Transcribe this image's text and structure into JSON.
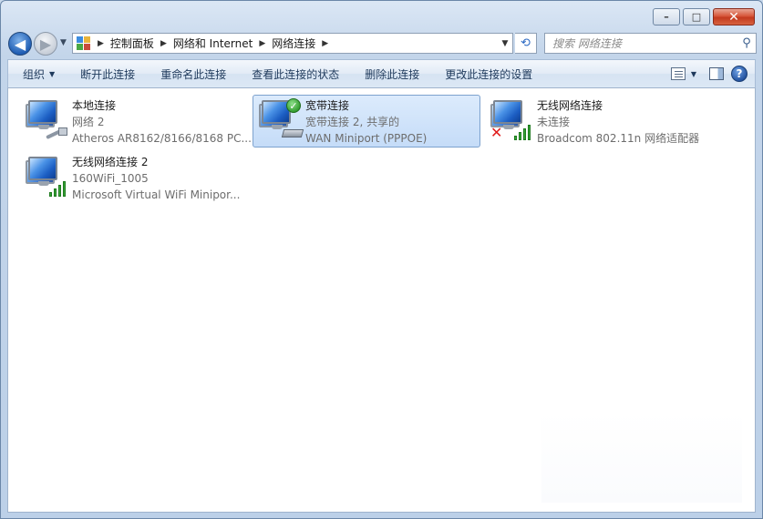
{
  "window": {
    "controls": {
      "minimize": "–",
      "maximize": "□",
      "close": "✕"
    }
  },
  "nav": {
    "back_icon": "back-arrow-icon",
    "forward_icon": "forward-arrow-icon",
    "breadcrumbs": [
      "控制面板",
      "网络和 Internet",
      "网络连接"
    ],
    "search_placeholder": "搜索 网络连接"
  },
  "toolbar": {
    "organize": "组织",
    "commands": [
      "断开此连接",
      "重命名此连接",
      "查看此连接的状态",
      "删除此连接",
      "更改此连接的设置"
    ]
  },
  "connections": [
    {
      "name": "本地连接",
      "status": "网络  2",
      "device": "Atheros AR8162/8166/8168 PC...",
      "type": "ethernet",
      "selected": false
    },
    {
      "name": "宽带连接",
      "status": "宽带连接  2, 共享的",
      "device": "WAN Miniport (PPPOE)",
      "type": "broadband-connected",
      "selected": true
    },
    {
      "name": "无线网络连接",
      "status": "未连接",
      "device": "Broadcom 802.11n 网络适配器",
      "type": "wireless-disconnected",
      "selected": false
    },
    {
      "name": "无线网络连接 2",
      "status": "160WiFi_1005",
      "device": "Microsoft Virtual WiFi Minipor...",
      "type": "wireless",
      "selected": false
    }
  ]
}
